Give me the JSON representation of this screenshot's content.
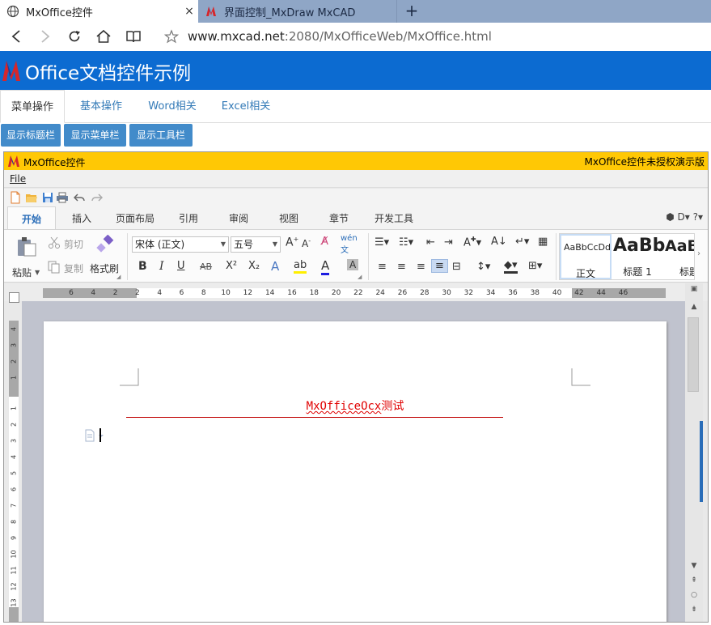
{
  "browser": {
    "tabs": [
      {
        "title": "MxOffice控件",
        "close": "×"
      },
      {
        "title": "界面控制_MxDraw MxCAD"
      }
    ],
    "new_tab": "+",
    "url_host": "www.mxcad.net",
    "url_rest": ":2080/MxOfficeWeb/MxOffice.html"
  },
  "header": {
    "title": "Office文档控件示例"
  },
  "page_tabs": [
    "菜单操作",
    "基本操作",
    "Word相关",
    "Excel相关"
  ],
  "buttons": [
    "显示标题栏",
    "显示菜单栏",
    "显示工具栏"
  ],
  "ocx": {
    "title": "MxOffice控件",
    "notice": "MxOffice控件未授权演示版",
    "menu_file": "File",
    "ribbon_tabs": [
      "开始",
      "插入",
      "页面布局",
      "引用",
      "审阅",
      "视图",
      "章节",
      "开发工具"
    ],
    "ribbon_tools": "⬢  D▾  ?▾",
    "clipboard": {
      "paste": "粘贴",
      "cut": "剪切",
      "copy": "复制",
      "format_painter": "格式刷"
    },
    "font_name": "宋体 (正文)",
    "font_size": "五号",
    "format_row": [
      "B",
      "I",
      "U",
      "AB",
      "X²",
      "X₂"
    ],
    "styles": [
      {
        "sample": "AaBbCcDd",
        "caption": "正文"
      },
      {
        "sample": "AaBb",
        "caption": "标题 1"
      },
      {
        "sample": "AaB",
        "caption": "标题"
      }
    ],
    "hruler_numbers": [
      "6",
      "4",
      "2",
      "2",
      "4",
      "6",
      "8",
      "10",
      "12",
      "14",
      "16",
      "18",
      "20",
      "22",
      "24",
      "26",
      "28",
      "30",
      "32",
      "34",
      "36",
      "38",
      "40",
      "42",
      "44",
      "46"
    ],
    "vruler_numbers": [
      "4",
      "3",
      "2",
      "1",
      "1",
      "2",
      "3",
      "4",
      "5",
      "6",
      "7",
      "8",
      "9",
      "10",
      "11",
      "12",
      "13"
    ],
    "doc_title_underlined": "MxOfficeOcx",
    "doc_title_rest": "测试"
  },
  "colors": {
    "header_blue": "#0c6bd1",
    "ocx_title_yellow": "#ffc805",
    "button_blue": "#428bca",
    "doc_red": "#e00000"
  }
}
